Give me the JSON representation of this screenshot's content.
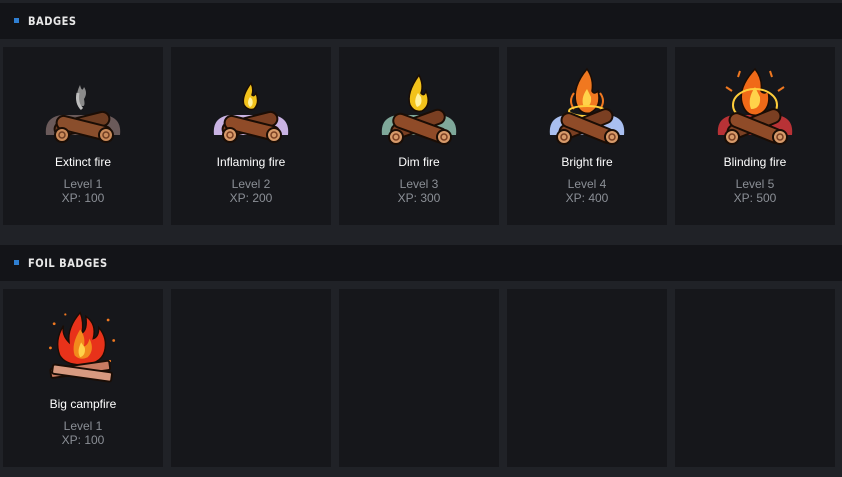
{
  "sections": {
    "badges": {
      "title": "BADGES"
    },
    "foil": {
      "title": "FOIL BADGES"
    }
  },
  "badges": [
    {
      "name": "Extinct fire",
      "level": "Level 1",
      "xp": "XP: 100",
      "icon": "extinct-fire-icon",
      "bg_color": "#6a5a5a"
    },
    {
      "name": "Inflaming fire",
      "level": "Level 2",
      "xp": "XP: 200",
      "icon": "inflaming-fire-icon",
      "bg_color": "#c9b3e3"
    },
    {
      "name": "Dim fire",
      "level": "Level 3",
      "xp": "XP: 300",
      "icon": "dim-fire-icon",
      "bg_color": "#7fa89a"
    },
    {
      "name": "Bright fire",
      "level": "Level 4",
      "xp": "XP: 400",
      "icon": "bright-fire-icon",
      "bg_color": "#a9bff0"
    },
    {
      "name": "Blinding fire",
      "level": "Level 5",
      "xp": "XP: 500",
      "icon": "blinding-fire-icon",
      "bg_color": "#b83236"
    }
  ],
  "foil_badges": [
    {
      "name": "Big campfire",
      "level": "Level 1",
      "xp": "XP: 100",
      "icon": "big-campfire-icon"
    }
  ]
}
